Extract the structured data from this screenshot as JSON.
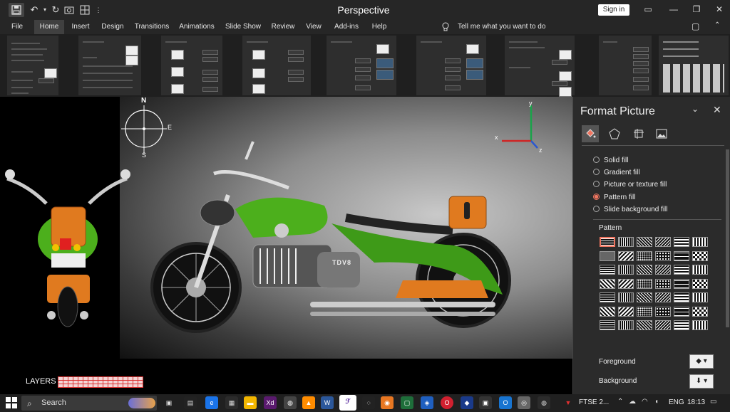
{
  "app": {
    "title": "Perspective",
    "sign_in": "Sign in",
    "quick_access": [
      "save-icon",
      "undo-icon",
      "redo-icon",
      "camera-icon",
      "grid-icon"
    ],
    "window_controls": [
      "ribbon-options-icon",
      "minimize-icon",
      "restore-icon",
      "close-icon"
    ]
  },
  "menu": {
    "tabs": [
      "File",
      "Home",
      "Insert",
      "Design",
      "Transitions",
      "Animations",
      "Slide Show",
      "Review",
      "View",
      "Add-ins",
      "Help"
    ],
    "active": "Home",
    "tell_me": "Tell me what you want to do"
  },
  "canvas": {
    "compass": {
      "n": "N",
      "e": "E",
      "s": "S"
    },
    "axes": {
      "x": "x",
      "y": "y",
      "z": "z"
    },
    "tank_badge": "TDV8",
    "layers_label": "LAYERS"
  },
  "format_pane": {
    "title": "Format Picture",
    "tab_icons": [
      "fill-bucket-icon",
      "pentagon-icon",
      "size-layout-icon",
      "picture-icon"
    ],
    "fill_options": [
      {
        "label": "Solid fill",
        "checked": false
      },
      {
        "label": "Gradient fill",
        "checked": false
      },
      {
        "label": "Picture or texture fill",
        "checked": false
      },
      {
        "label": "Pattern fill",
        "checked": true
      },
      {
        "label": "Slide background fill",
        "checked": false
      }
    ],
    "pattern_label": "Pattern",
    "foreground_label": "Foreground",
    "background_label": "Background"
  },
  "taskbar": {
    "search": "Search",
    "ftse": "FTSE 2...",
    "lang": "ENG",
    "time": "18:13"
  },
  "colors": {
    "bike_green": "#4caf1c",
    "accent": "#f07560",
    "seat_orange": "#e07a1f"
  }
}
